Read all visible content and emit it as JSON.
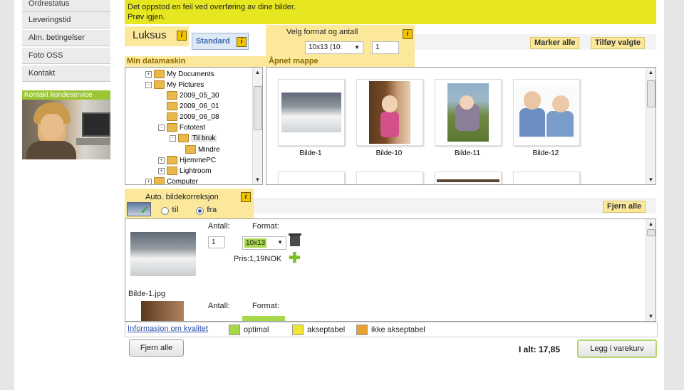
{
  "nav": {
    "items": [
      {
        "label": "Ordrestatus"
      },
      {
        "label": "Leveringstid"
      },
      {
        "label": "Alm. betingelser"
      },
      {
        "label": "Foto OSS"
      },
      {
        "label": "Kontakt"
      }
    ],
    "contact_label": "Kontakt kundeservice"
  },
  "error": {
    "line1": "Det oppstod en feil ved overføring av dine bilder.",
    "line2": "Prøv igjen."
  },
  "tabs": {
    "luksus": "Luksus",
    "standard": "Standard",
    "info": "i"
  },
  "format_panel": {
    "title": "Velg format og antall",
    "format_value": "10x13 (10:",
    "quantity_value": "1"
  },
  "toolbar": {
    "mark_all": "Marker alle",
    "add_selected": "Tilføy valgte"
  },
  "headers": {
    "my_computer": "Min datamaskin",
    "opened_folder": "Åpnet mappe"
  },
  "tree": [
    {
      "label": "My Documents",
      "expander": "+"
    },
    {
      "label": "My Pictures",
      "expander": "-"
    },
    {
      "label": "2009_05_30",
      "expander": ""
    },
    {
      "label": "2009_06_01",
      "expander": ""
    },
    {
      "label": "2009_06_08",
      "expander": ""
    },
    {
      "label": "Fototest",
      "expander": "-"
    },
    {
      "label": "Til bruk",
      "expander": "-"
    },
    {
      "label": "Mindre",
      "expander": ""
    },
    {
      "label": "HjemmePC",
      "expander": "+"
    },
    {
      "label": "Lightroom",
      "expander": "+"
    },
    {
      "label": "Computer",
      "expander": "+"
    }
  ],
  "thumbnails": [
    {
      "caption": "Bilde-1"
    },
    {
      "caption": "Bilde-10"
    },
    {
      "caption": "Bilde-11"
    },
    {
      "caption": "Bilde-12"
    }
  ],
  "autocorrect": {
    "title": "Auto. bildekorreksjon",
    "on_label": "til",
    "off_label": "fra",
    "selected": "fra"
  },
  "remove_all_top": "Fjern alle",
  "order": {
    "qty_label": "Antall:",
    "format_label": "Format:",
    "qty_value": "1",
    "format_value": "10x13",
    "price": "Pris:1,19NOK",
    "filename": "Bilde-1.jpg",
    "qty_label_2": "Antall:",
    "format_label_2": "Format:"
  },
  "legend": {
    "link": "Informasjon om kvalitet",
    "optimal": "optimal",
    "acceptable": "akseptabel",
    "not_acceptable": "ikke akseptabel",
    "colors": {
      "optimal": "#a6d84a",
      "acceptable": "#f2e531",
      "not_acceptable": "#e7a132"
    }
  },
  "footer": {
    "remove_all": "Fjern alle",
    "total": "I alt: 17,85",
    "add_to_cart": "Legg i varekurv"
  }
}
